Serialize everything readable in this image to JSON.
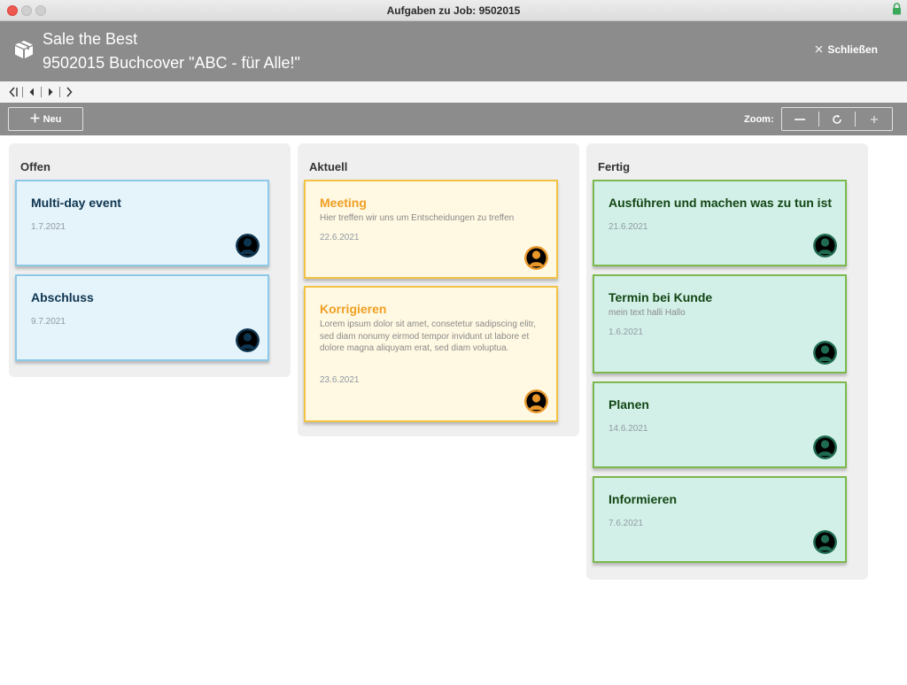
{
  "window": {
    "title": "Aufgaben zu Job:  9502015"
  },
  "header": {
    "line1": "Sale the Best",
    "line2": "9502015 Buchcover \"ABC -  für Alle!\"",
    "close_label": "Schließen",
    "icon": "box-icon"
  },
  "nav": {
    "icons": [
      "first-icon",
      "previous-icon",
      "next-icon",
      "last-icon"
    ]
  },
  "toolbar": {
    "new_label": "Neu",
    "zoom_label": "Zoom:",
    "zoom_icons": [
      "zoom-out-icon",
      "reset-icon",
      "zoom-in-icon"
    ]
  },
  "colors": {
    "bar": "#8c8c8c",
    "open_card": "#e5f3fa",
    "open_border": "#8dc8e8",
    "current_card": "#fff8e2",
    "current_border": "#f2c244",
    "done_card": "#d3f0e8",
    "done_border": "#7bb84e",
    "avatar_open": "#0e3550",
    "avatar_current": "#e8962a",
    "avatar_done": "#1f6b50"
  },
  "board": {
    "columns": [
      {
        "title": "Offen",
        "cards": [
          {
            "title": "Multi-day event",
            "description": "",
            "date": "1.7.2021"
          },
          {
            "title": "Abschluss",
            "description": "",
            "date": "9.7.2021"
          }
        ]
      },
      {
        "title": "Aktuell",
        "cards": [
          {
            "title": "Meeting",
            "description": "Hier treffen wir uns um Entscheidungen zu treffen",
            "date": "22.6.2021"
          },
          {
            "title": "Korrigieren",
            "description": "Lorem ipsum dolor sit amet, consetetur sadipscing elitr, sed diam nonumy eirmod tempor invidunt ut labore et dolore magna aliquyam erat, sed diam voluptua.",
            "date": "23.6.2021"
          }
        ]
      },
      {
        "title": "Fertig",
        "cards": [
          {
            "title": "Ausführen und machen was zu tun ist",
            "description": "",
            "date": "21.6.2021"
          },
          {
            "title": "Termin bei Kunde",
            "description": "mein text halli Hallo",
            "date": "1.6.2021"
          },
          {
            "title": "Planen",
            "description": "",
            "date": "14.6.2021"
          },
          {
            "title": "Informieren",
            "description": "",
            "date": "7.6.2021"
          }
        ]
      }
    ]
  }
}
